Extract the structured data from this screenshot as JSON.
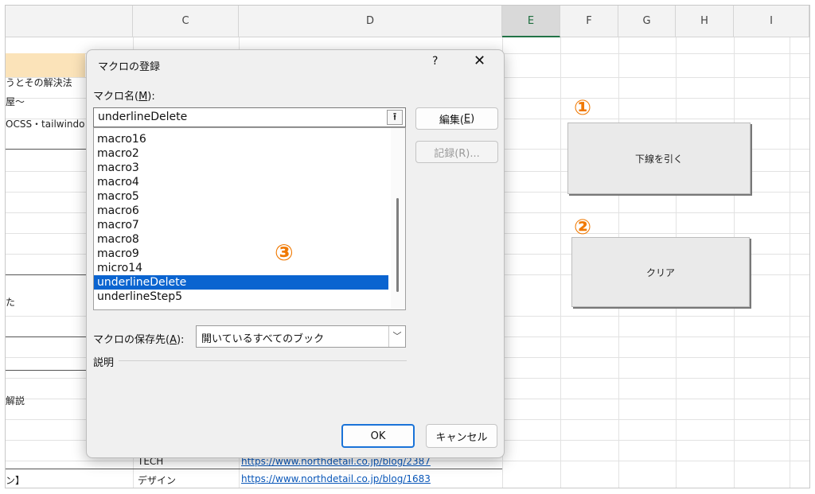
{
  "columns": [
    "C",
    "D",
    "E",
    "F",
    "G",
    "H",
    "I"
  ],
  "cells": {
    "a_rows": [
      "うとその解決法",
      "屋～",
      "OCSS・tailwindo",
      "た",
      "解説",
      "ン】"
    ],
    "c_row_bottom": "デザイン",
    "c_row_partial": "TECH",
    "d_link_partial": "https://www.northdetail.co.jp/blog/2387",
    "d_link_bottom": "https://www.northdetail.co.jp/blog/1683"
  },
  "sheet_buttons": {
    "underline": "下線を引く",
    "clear": "クリア"
  },
  "markers": {
    "one": "①",
    "two": "②",
    "three": "③"
  },
  "dialog": {
    "title": "マクロの登録",
    "help": "?",
    "close": "✕",
    "macro_name_label_pre": "マクロ名(",
    "macro_name_label_key": "M",
    "macro_name_label_post": "):",
    "macro_name_value": "underlineDelete",
    "up_icon": "⭱",
    "macros": [
      "macro16",
      "macro2",
      "macro3",
      "macro4",
      "macro5",
      "macro6",
      "macro7",
      "macro8",
      "macro9",
      "micro14",
      "underlineDelete",
      "underlineStep5"
    ],
    "selected_macro": "underlineDelete",
    "edit_pre": "編集(",
    "edit_key": "E",
    "edit_post": ")",
    "record_label": "記録(R)...",
    "store_label_pre": "マクロの保存先(",
    "store_label_key": "A",
    "store_label_post": "):",
    "store_value": "開いているすべてのブック",
    "description_label": "説明",
    "ok": "OK",
    "cancel": "キャンセル"
  }
}
